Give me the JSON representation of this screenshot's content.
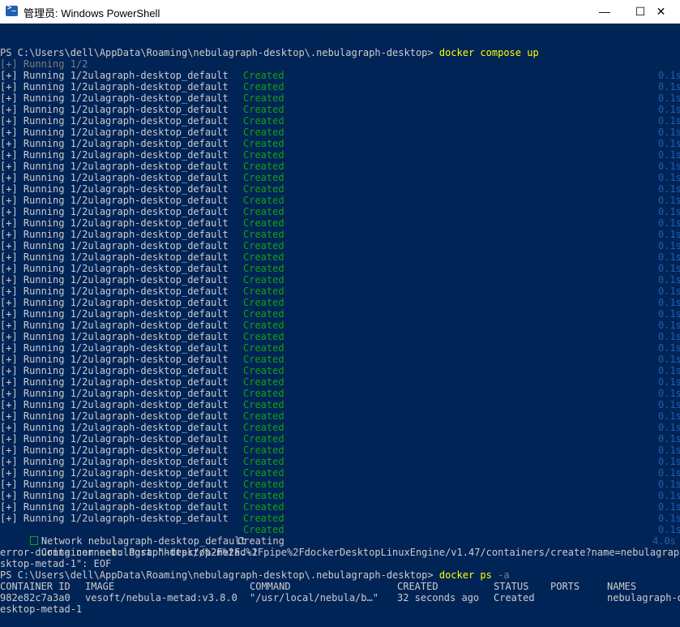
{
  "window": {
    "title": "管理员: Windows PowerShell",
    "icon": "powershell-icon",
    "minimize": "—",
    "maximize": "☐",
    "close": "✕"
  },
  "colors": {
    "background": "#012456",
    "text": "#cccccc",
    "command": "#ffff00",
    "created": "#13a10e",
    "timing": "#1f5fb0",
    "dim": "#7f7f7f"
  },
  "terminal": {
    "prompt1": "PS C:\\Users\\dell\\AppData\\Roaming\\nebulagraph-desktop\\.nebulagraph-desktop> ",
    "command1": "docker compose up",
    "running_header": "[+] Running 1/2",
    "running_line_text": "[+] Running 1/2ulagraph-desktop_default",
    "created_text": "Created",
    "running_repeat_count": 40,
    "network_line": "Network nebulagraph-desktop_default",
    "network_status": "Created",
    "container_line": " - Container nebulagraph-desktop-metad-1",
    "container_status": "Creating",
    "container_time": "4.0s",
    "timing_fragments": [
      "0.1s",
      "0.1s"
    ],
    "error_line1": "error during connect: Post \"http://%2F%2F.%2Fpipe%2FdockerDesktopLinuxEngine/v1.47/containers/create?name=nebulagraph-desktop-",
    "error_line2": "sktop-metad-1\": EOF",
    "prompt2": "PS C:\\Users\\dell\\AppData\\Roaming\\nebulagraph-desktop\\.nebulagraph-desktop> ",
    "command2": "docker ps",
    "command2_flag": " -a",
    "ps_headers": [
      "CONTAINER ID",
      "IMAGE",
      "COMMAND",
      "CREATED",
      "STATUS",
      "PORTS",
      "NAMES"
    ],
    "ps_row": [
      "982e82c7a3a0",
      "vesoft/nebula-metad:v3.8.0",
      "\"/usr/local/nebula/b…\"",
      "32 seconds ago",
      "Created",
      "",
      "nebulagraph-desktop-metad-1"
    ],
    "ps_row_wrap": "esktop-metad-1"
  }
}
